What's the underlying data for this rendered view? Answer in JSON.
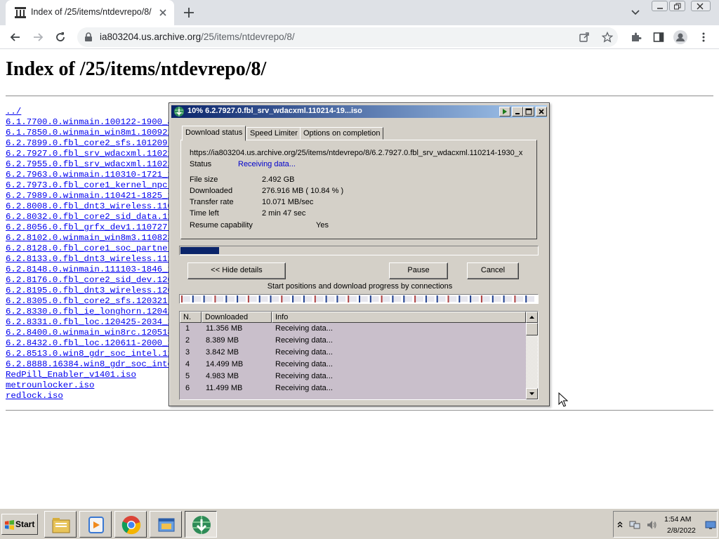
{
  "browser": {
    "tab_title": "Index of /25/items/ntdevrepo/8/",
    "url_host": "ia803204.us.archive.org",
    "url_path": "/25/items/ntdevrepo/8/"
  },
  "page": {
    "heading": "Index of /25/items/ntdevrepo/8/",
    "links": [
      "../",
      "6.1.7700.0.winmain.100122-1900_an",
      "6.1.7850.0.winmain_win8m1.100922-",
      "6.2.7899.0.fbl_core2_sfs.101209-1",
      "6.2.7927.0.fbl_srv_wdacxml.110214",
      "6.2.7955.0.fbl_srv_wdacxml.110228",
      "6.2.7963.0.winmain.110310-1721_x8",
      "6.2.7973.0.fbl_core1_kernel_npc.1",
      "6.2.7989.0.winmain.110421-1825_x8",
      "6.2.8008.0.fbl_dnt3_wireless.1105",
      "6.2.8032.0.fbl_core2_sid_data.110",
      "6.2.8056.0.fbl_grfx_dev1.110727-1",
      "6.2.8102.0.winmain_win8m3.110823-",
      "6.2.8128.0.fbl_core1_soc_partner",
      "6.2.8133.0.fbl_dnt3_wireless.1110",
      "6.2.8148.0.winmain.111103-1846_x8",
      "6.2.8176.0.fbl_core2_sid_dev.1201",
      "6.2.8195.0.fbl_dnt3_wireless.1202",
      "6.2.8305.0.fbl_core2_sfs.120321-1",
      "6.2.8330.0.fbl_ie_longhorn.120425",
      "6.2.8331.0.fbl_loc.120425-2034_x8",
      "6.2.8400.0.winmain_win8rc.120518-",
      "6.2.8432.0.fbl_loc.120611-2000_x8",
      "6.2.8513.0.win8_gdr_soc_intel.120",
      "6.2.8888.16384.win8_gdr_soc_intel",
      "RedPill_Enabler_v1401.iso",
      "metrounlocker.iso",
      "redlock.iso"
    ]
  },
  "dialog": {
    "title": "10% 6.2.7927.0.fbl_srv_wdacxml.110214-19...iso",
    "tabs": [
      "Download status",
      "Speed Limiter",
      "Options on completion"
    ],
    "url": "https://ia803204.us.archive.org/25/items/ntdevrepo/8/6.2.7927.0.fbl_srv_wdacxml.110214-1930_x",
    "status_label": "Status",
    "status_value": "Receiving data...",
    "file_size_label": "File size",
    "file_size_value": "2.492  GB",
    "downloaded_label": "Downloaded",
    "downloaded_value": "276.916  MB  ( 10.84 % )",
    "transfer_rate_label": "Transfer rate",
    "transfer_rate_value": "10.071  MB/sec",
    "time_left_label": "Time left",
    "time_left_value": "2 min 47 sec",
    "resume_label": "Resume capability",
    "resume_value": "Yes",
    "progress_fraction": 0.1084,
    "hide_details_label": "<< Hide details",
    "pause_label": "Pause",
    "cancel_label": "Cancel",
    "connections_caption": "Start positions and download progress by connections",
    "table_headers": [
      "N.",
      "Downloaded",
      "Info"
    ],
    "rows": [
      {
        "n": "1",
        "downloaded": "11.356  MB",
        "info": "Receiving data..."
      },
      {
        "n": "2",
        "downloaded": "8.389  MB",
        "info": "Receiving data..."
      },
      {
        "n": "3",
        "downloaded": "3.842  MB",
        "info": "Receiving data..."
      },
      {
        "n": "4",
        "downloaded": "14.499  MB",
        "info": "Receiving data..."
      },
      {
        "n": "5",
        "downloaded": "4.983  MB",
        "info": "Receiving data..."
      },
      {
        "n": "6",
        "downloaded": "11.499  MB",
        "info": "Receiving data..."
      }
    ]
  },
  "taskbar": {
    "start_label": "Start",
    "time": "1:54 AM",
    "date": "2/8/2022"
  }
}
